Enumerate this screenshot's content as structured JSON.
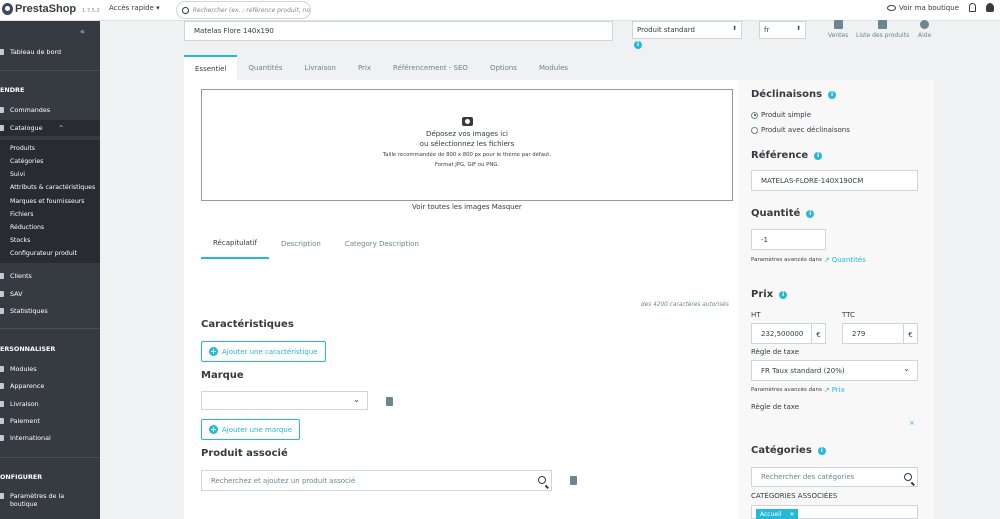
{
  "topbar": {
    "brand": "PrestaShop",
    "version": "1.7.5.2",
    "quick_access": "Accès rapide",
    "search_placeholder": "Rechercher (ex. : référence produit, no",
    "view_shop": "Voir ma boutique"
  },
  "sidebar": {
    "dashboard": "Tableau de bord",
    "sell_section": "ENDRE",
    "orders": "Commandes",
    "catalog": "Catalogue",
    "catalog_sub": [
      "Produits",
      "Catégories",
      "Suivi",
      "Attributs & caractéristiques",
      "Marques et fournisseurs",
      "Fichiers",
      "Réductions",
      "Stocks",
      "Configurateur produit"
    ],
    "clients": "Clients",
    "sav": "SAV",
    "stats": "Statistiques",
    "personalize_section": "ERSONNALISER",
    "modules": "Modules",
    "appearance": "Apparence",
    "shipping": "Livraison",
    "payment": "Paiement",
    "international": "International",
    "configure_section": "ONFIGURER",
    "shop_params_1": "Paramètres de la",
    "shop_params_2": "boutique"
  },
  "header": {
    "product_name": "Matelas Flore 140x190",
    "product_type": "Produit standard",
    "language": "fr",
    "tools": [
      "Ventes",
      "Liste des produits",
      "Aide"
    ]
  },
  "tabs": [
    "Essentiel",
    "Quantités",
    "Livraison",
    "Prix",
    "Référencement - SEO",
    "Options",
    "Modules"
  ],
  "images": {
    "dropzone_line1": "Déposez vos images ici",
    "dropzone_line2": "ou sélectionnez les fichiers",
    "dropzone_line3": "Taille recommandée de 800 x 800 px pour le thème par défaut.",
    "dropzone_line4": "Format JPG, GIF ou PNG.",
    "links": "Voir toutes les images Masquer"
  },
  "desc_tabs": [
    "Récapitulatif",
    "Description",
    "Category Description"
  ],
  "char_count": "des 4200 caractères autorisés",
  "features": {
    "title": "Caractéristiques",
    "add_button": "Ajouter une caractéristique"
  },
  "brand": {
    "title": "Marque",
    "add_button": "Ajouter une marque"
  },
  "related": {
    "title": "Produit associé",
    "placeholder": "Recherchez et ajoutez un produit associé"
  },
  "combinations": {
    "title": "Déclinaisons",
    "option_simple": "Produit simple",
    "option_combos": "Produit avec déclinaisons"
  },
  "reference": {
    "title": "Référence",
    "value": "MATELAS-FLORE-140X190CM"
  },
  "quantity": {
    "title": "Quantité",
    "value": "-1",
    "adv_label": "Paramètres avancés dans",
    "adv_link": "Quantités"
  },
  "price": {
    "title": "Prix",
    "ht_label": "HT",
    "ht_value": "232,500000",
    "ttc_label": "TTC",
    "ttc_value": "279",
    "currency": "€",
    "tax_rule_label": "Règle de taxe",
    "tax_rule_value": "FR Taux standard (20%)",
    "adv_label": "Paramètres avancés dans",
    "adv_link": "Prix",
    "tax_rule_label2": "Règle de taxe",
    "close_x": "×"
  },
  "categories": {
    "title": "Catégories",
    "search_placeholder": "Rechercher des catégories",
    "associated_label": "CATÉGORIES ASSOCIÉES",
    "chip": "Accueil",
    "chip_x": "✕"
  }
}
